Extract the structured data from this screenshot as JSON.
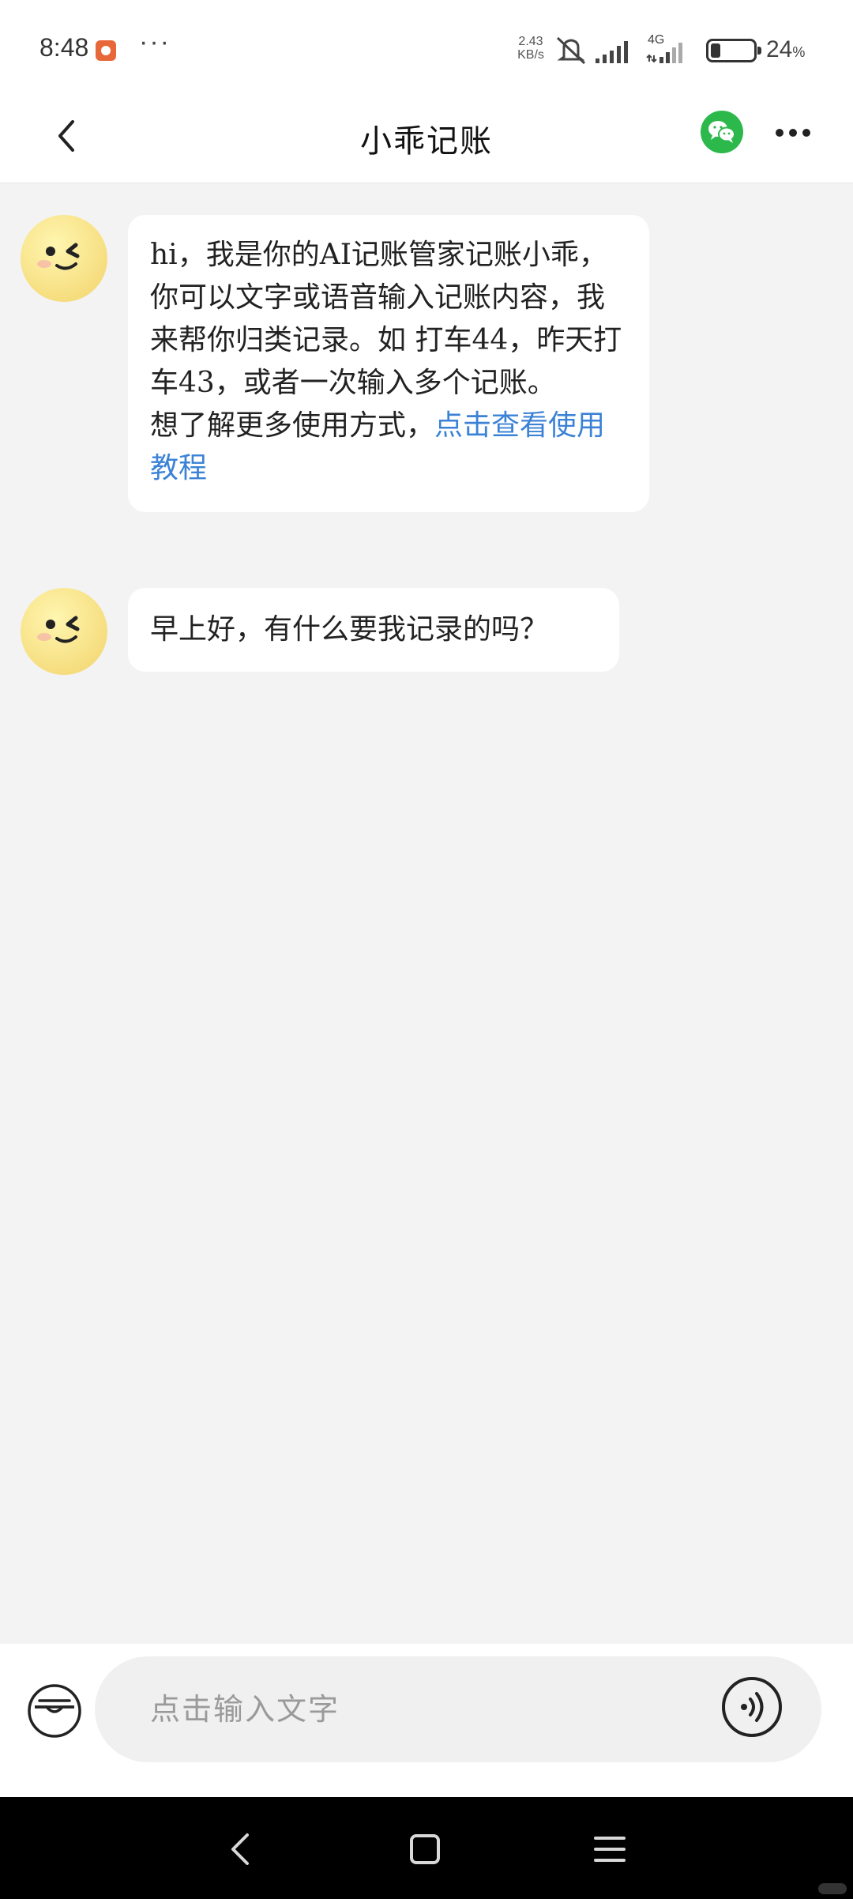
{
  "status_bar": {
    "time": "8:48",
    "network_speed_value": "2.43",
    "network_speed_unit": "KB/s",
    "network_type": "4G",
    "battery_percent": "24",
    "battery_unit": "%",
    "battery_level": 0.24
  },
  "header": {
    "title": "小乖记账"
  },
  "messages": [
    {
      "text": "hi，我是你的AI记账管家记账小乖，你可以文字或语音输入记账内容，我来帮你归类记录。如 打车44，昨天打车43，或者一次输入多个记账。",
      "text2": "想了解更多使用方式，",
      "link": "点击查看使用教程"
    },
    {
      "text": "早上好，有什么要我记录的吗？"
    }
  ],
  "input": {
    "placeholder": "点击输入文字"
  },
  "colors": {
    "link": "#3b82d6",
    "wechat": "#2db84c",
    "background": "#f3f3f3"
  }
}
